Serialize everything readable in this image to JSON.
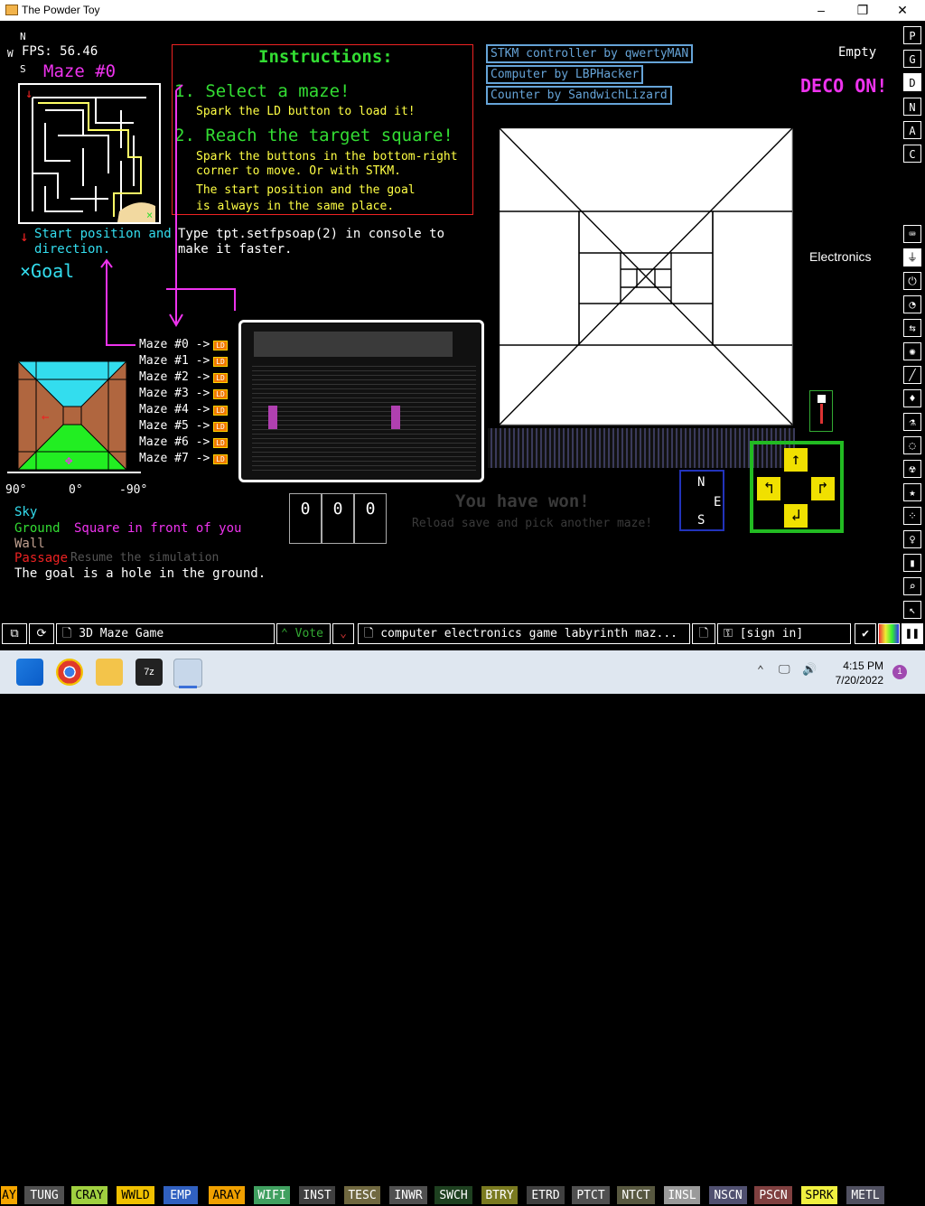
{
  "window": {
    "title": "The Powder Toy",
    "minimize": "–",
    "maximize": "❐",
    "close": "✕"
  },
  "hud": {
    "fps": "FPS: 56.46",
    "compass_n": "N",
    "compass_w": "W",
    "compass_e": "E",
    "compass_s": "S",
    "maze_title": "Maze #0",
    "empty": "Empty",
    "deco": "DECO ON!",
    "electronics": "Electronics"
  },
  "instructions": {
    "title": "Instructions:",
    "step1": "1. Select a maze!",
    "step1_sub": "Spark the LD button to load it!",
    "step2": "2. Reach the target square!",
    "step2_sub1": "Spark the buttons in the bottom-right",
    "step2_sub2": "corner to move. Or with STKM.",
    "step2_sub3": "The start position and the goal",
    "step2_sub4": "is always in the same place."
  },
  "tip": {
    "line1": "Type tpt.setfpsoap(2) in console to",
    "line2": "make it faster."
  },
  "start_text": {
    "line1": "Start position and",
    "line2": "direction.",
    "goal": "×Goal"
  },
  "credits": [
    "STKM controller by qwertyMAN",
    "Computer by LBPHacker",
    "Counter by SandwichLizard"
  ],
  "mazes": [
    "Maze #0 ->",
    "Maze #1 ->",
    "Maze #2 ->",
    "Maze #3 ->",
    "Maze #4 ->",
    "Maze #5 ->",
    "Maze #6 ->",
    "Maze #7 ->"
  ],
  "ld_label": "LD",
  "angles": {
    "left": "90°",
    "center": "0°",
    "right": "-90°"
  },
  "legend": {
    "sky": "Sky",
    "ground": "Ground",
    "square": "Square in front of you",
    "wall": "Wall",
    "passage": "Passage",
    "resume": "Resume the simulation",
    "goal_hole": "The goal is a hole in the ground."
  },
  "counter": [
    "0",
    "0",
    "0"
  ],
  "win": {
    "line1": "You have won!",
    "line2": "Reload save and pick another maze!"
  },
  "nav": {
    "n": "N",
    "e": "E",
    "s": "S"
  },
  "side_menu": [
    "P",
    "G",
    "D",
    "N",
    "A",
    "C"
  ],
  "elements": [
    {
      "label": "AY",
      "bg": "#f5a600",
      "fg": "#000"
    },
    {
      "label": "TUNG",
      "bg": "#505050",
      "fg": "#fff"
    },
    {
      "label": "CRAY",
      "bg": "#a0d040",
      "fg": "#000"
    },
    {
      "label": "WWLD",
      "bg": "#f0c000",
      "fg": "#000"
    },
    {
      "label": "EMP",
      "bg": "#3060c0",
      "fg": "#fff"
    },
    {
      "label": "ARAY",
      "bg": "#f0a000",
      "fg": "#000"
    },
    {
      "label": "WIFI",
      "bg": "#40a060",
      "fg": "#fff"
    },
    {
      "label": "INST",
      "bg": "#404040",
      "fg": "#fff"
    },
    {
      "label": "TESC",
      "bg": "#706840",
      "fg": "#fff"
    },
    {
      "label": "INWR",
      "bg": "#505050",
      "fg": "#fff"
    },
    {
      "label": "SWCH",
      "bg": "#1e4020",
      "fg": "#fff"
    },
    {
      "label": "BTRY",
      "bg": "#7a7a20",
      "fg": "#fff"
    },
    {
      "label": "ETRD",
      "bg": "#404040",
      "fg": "#fff"
    },
    {
      "label": "PTCT",
      "bg": "#505050",
      "fg": "#fff"
    },
    {
      "label": "NTCT",
      "bg": "#585840",
      "fg": "#fff"
    },
    {
      "label": "INSL",
      "bg": "#9a9a9a",
      "fg": "#fff"
    },
    {
      "label": "NSCN",
      "bg": "#505070",
      "fg": "#fff"
    },
    {
      "label": "PSCN",
      "bg": "#804040",
      "fg": "#fff"
    },
    {
      "label": "SPRK",
      "bg": "#f0f040",
      "fg": "#000"
    },
    {
      "label": "METL",
      "bg": "#505060",
      "fg": "#fff"
    }
  ],
  "bottom": {
    "save_name": "3D Maze Game",
    "vote": "Vote",
    "tags": "computer electronics game labyrinth maz...",
    "signin": "[sign in]"
  },
  "taskbar": {
    "time": "4:15 PM",
    "date": "7/20/2022",
    "badge": "1"
  },
  "colors": {
    "green": "#33dd33",
    "magenta": "#ee33ee",
    "cyan": "#33ddee",
    "red": "#ee2222",
    "blue_text": "#66a4d8"
  }
}
